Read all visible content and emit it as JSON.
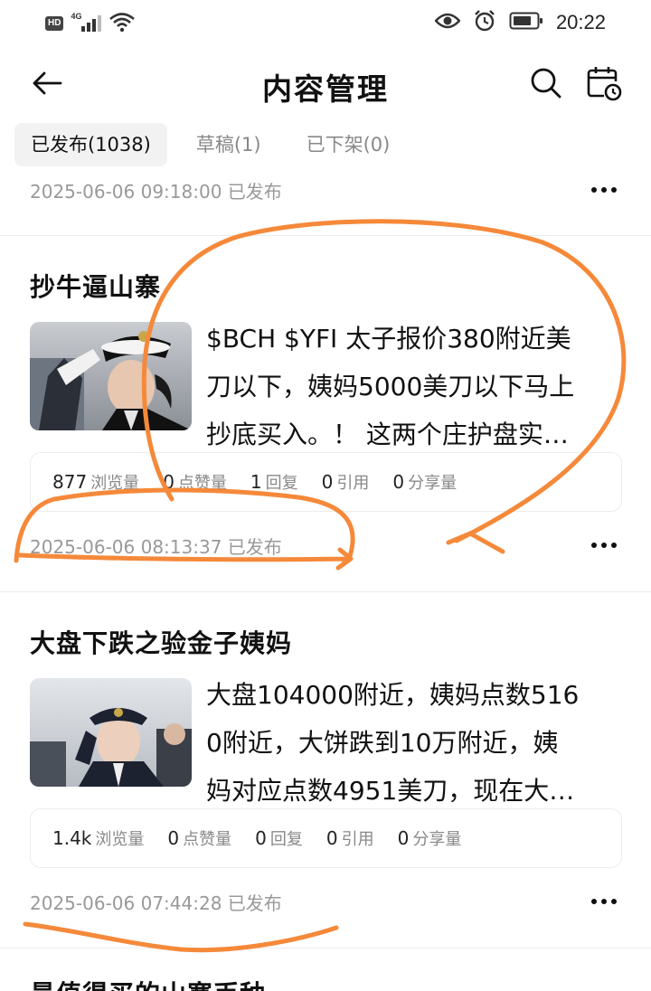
{
  "status_bar": {
    "hd_badge": "HD",
    "network": "4G",
    "time": "20:22",
    "icons": [
      "hd-icon",
      "signal-4g-icon",
      "wifi-icon",
      "eye-icon",
      "alarm-icon",
      "battery-icon"
    ]
  },
  "header": {
    "title": "内容管理",
    "icons": [
      "back-arrow-icon",
      "search-icon",
      "calendar-clock-icon"
    ]
  },
  "tabs": [
    {
      "label": "已发布(1038)",
      "active": true
    },
    {
      "label": "草稿(1)",
      "active": false
    },
    {
      "label": "已下架(0)",
      "active": false
    }
  ],
  "first_meta": "2025-06-06 09:18:00 已发布",
  "posts": [
    {
      "title": "抄牛逼山寨",
      "excerpt_lines": [
        "$BCH $YFI 太子报价380附近美",
        "刀以下，姨妈5000美刀以下马上",
        "抄底买入。！ 这两个庄护盘实…"
      ],
      "stats": [
        {
          "num": "877",
          "label": "浏览量"
        },
        {
          "num": "0",
          "label": "点赞量"
        },
        {
          "num": "1",
          "label": "回复"
        },
        {
          "num": "0",
          "label": "引用"
        },
        {
          "num": "0",
          "label": "分享量"
        }
      ],
      "meta": "2025-06-06 08:13:37 已发布"
    },
    {
      "title": "大盘下跌之验金子姨妈",
      "excerpt_lines": [
        "大盘104000附近，姨妈点数516",
        "0附近，大饼跌到10万附近，姨",
        "妈对应点数4951美刀，现在大…"
      ],
      "stats": [
        {
          "num": "1.4k",
          "label": "浏览量"
        },
        {
          "num": "0",
          "label": "点赞量"
        },
        {
          "num": "0",
          "label": "回复"
        },
        {
          "num": "0",
          "label": "引用"
        },
        {
          "num": "0",
          "label": "分享量"
        }
      ],
      "meta": "2025-06-06 07:44:28 已发布"
    }
  ],
  "next_post_title_partial": "最值得买的山寨币种",
  "annotation_color": "#f5893a"
}
